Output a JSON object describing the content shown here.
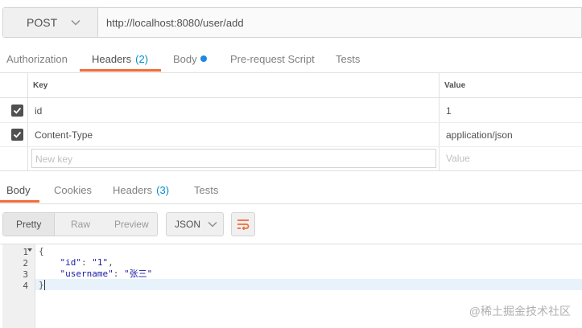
{
  "request": {
    "method": "POST",
    "url": "http://localhost:8080/user/add"
  },
  "request_tabs": [
    {
      "label": "Authorization"
    },
    {
      "label": "Headers",
      "count": "(2)"
    },
    {
      "label": "Body"
    },
    {
      "label": "Pre-request Script"
    },
    {
      "label": "Tests"
    }
  ],
  "headers_table": {
    "key_header": "Key",
    "value_header": "Value",
    "rows": [
      {
        "key": "id",
        "value": "1",
        "checked": true
      },
      {
        "key": "Content-Type",
        "value": "application/json",
        "checked": true
      }
    ],
    "new_key_placeholder": "New key",
    "new_value_placeholder": "Value"
  },
  "response_tabs": [
    {
      "label": "Body"
    },
    {
      "label": "Cookies"
    },
    {
      "label": "Headers",
      "count": "(3)"
    },
    {
      "label": "Tests"
    }
  ],
  "view_modes": [
    "Pretty",
    "Raw",
    "Preview"
  ],
  "format": "JSON",
  "code": {
    "line_numbers": [
      "1",
      "2",
      "3",
      "4"
    ],
    "open_brace": "{",
    "key1": "\"id\"",
    "val1": "\"1\"",
    "key2": "\"username\"",
    "val2": "\"张三\"",
    "close_brace": "}"
  },
  "watermark": "@稀土掘金技术社区",
  "colors": {
    "accent": "#f26b3a",
    "count": "#008dcb",
    "dot": "#1e88e5"
  }
}
